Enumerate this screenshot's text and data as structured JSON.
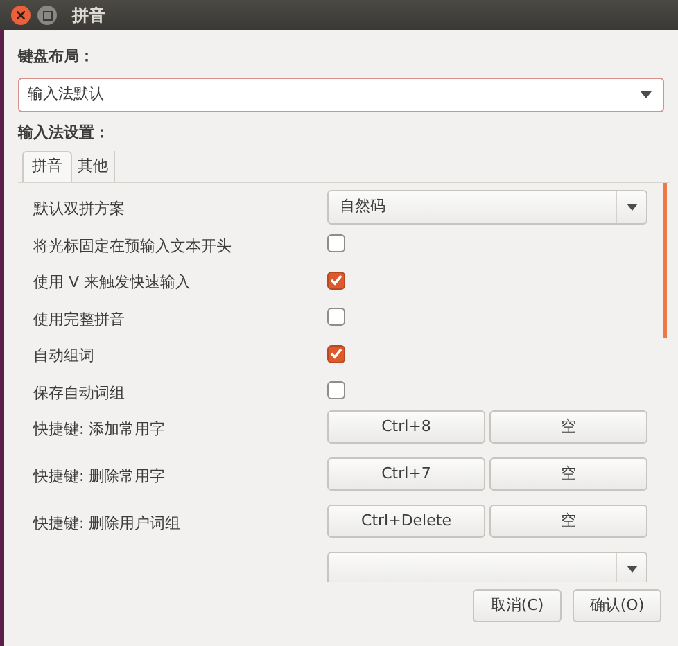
{
  "window": {
    "title": "拼音"
  },
  "keyboard_layout": {
    "label": "键盘布局：",
    "value": "输入法默认"
  },
  "im_settings": {
    "label": "输入法设置："
  },
  "tabs": [
    {
      "label": "拼音",
      "selected": true
    },
    {
      "label": "其他",
      "selected": false
    }
  ],
  "settings": [
    {
      "kind": "combo",
      "label": "默认双拼方案",
      "value": "自然码"
    },
    {
      "kind": "checkbox",
      "label": "将光标固定在预输入文本开头",
      "checked": false
    },
    {
      "kind": "checkbox",
      "label": "使用 V 来触发快速输入",
      "checked": true
    },
    {
      "kind": "checkbox",
      "label": "使用完整拼音",
      "checked": false
    },
    {
      "kind": "checkbox",
      "label": "自动组词",
      "checked": true
    },
    {
      "kind": "checkbox",
      "label": "保存自动词组",
      "checked": false
    },
    {
      "kind": "shortcut",
      "label": "快捷键: 添加常用字",
      "keys": [
        "Ctrl+8",
        "空"
      ]
    },
    {
      "kind": "shortcut",
      "label": "快捷键: 删除常用字",
      "keys": [
        "Ctrl+7",
        "空"
      ]
    },
    {
      "kind": "shortcut",
      "label": "快捷键: 删除用户词组",
      "keys": [
        "Ctrl+Delete",
        "空"
      ]
    },
    {
      "kind": "combo"
    }
  ],
  "buttons": [
    "取消(C)",
    "确认(O)"
  ]
}
